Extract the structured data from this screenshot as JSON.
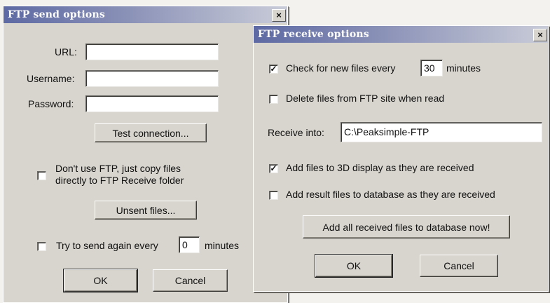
{
  "send_dialog": {
    "title": "FTP send options",
    "close_glyph": "×",
    "url_label": "URL:",
    "url_value": "",
    "username_label": "Username:",
    "username_value": "",
    "password_label": "Password:",
    "password_value": "",
    "test_connection_label": "Test connection...",
    "dont_use_ftp_line1": "Don't use FTP, just copy files",
    "dont_use_ftp_line2": "directly to FTP Receive folder",
    "dont_use_ftp_checked": false,
    "unsent_files_label": "Unsent files...",
    "retry_label": "Try to send again every",
    "retry_value": "0",
    "retry_unit": "minutes",
    "retry_checked": false,
    "ok_label": "OK",
    "cancel_label": "Cancel"
  },
  "receive_dialog": {
    "title": "FTP receive options",
    "close_glyph": "×",
    "check_new_label": "Check for new files every",
    "check_new_value": "30",
    "check_new_unit": "minutes",
    "check_new_checked": true,
    "delete_files_label": "Delete files from FTP site when read",
    "delete_files_checked": false,
    "receive_into_label": "Receive into:",
    "receive_into_value": "C:\\Peaksimple-FTP",
    "add_3d_label": "Add files to 3D display as they are received",
    "add_3d_checked": true,
    "add_db_label": "Add result files to database as they are received",
    "add_db_checked": false,
    "add_all_label": "Add all received files to database now!",
    "ok_label": "OK",
    "cancel_label": "Cancel"
  },
  "check_glyph": "✓"
}
